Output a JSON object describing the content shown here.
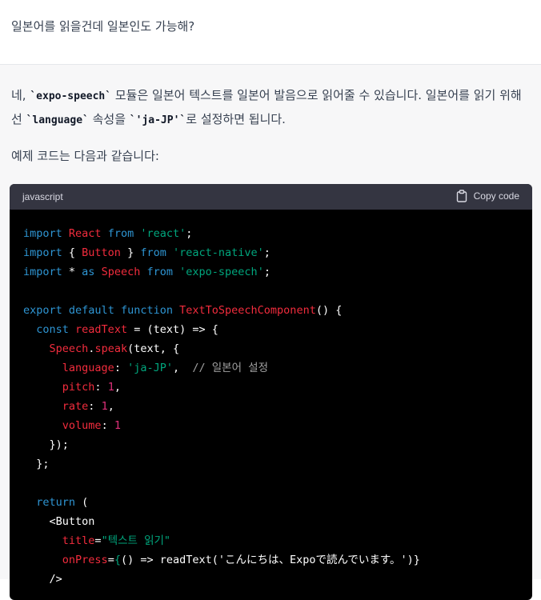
{
  "user_message": "일본어를 읽을건데 일본인도 가능해?",
  "answer": {
    "p1_a": "네, ",
    "p1_code1": "`expo-speech`",
    "p1_b": " 모듈은 일본어 텍스트를 일본어 발음으로 읽어줄 수 있습니다. 일본어를 읽기 위해선 ",
    "p1_code2": "`language`",
    "p1_c": " 속성을 ",
    "p1_code3": "`'ja-JP'`",
    "p1_d": "로 설정하면 됩니다.",
    "p2": "예제 코드는 다음과 같습니다:"
  },
  "code_block": {
    "language": "javascript",
    "copy_label": "Copy code",
    "colors": {
      "keyword": "#2e95d3",
      "identifier": "#f22c3d",
      "string": "#00a67d",
      "comment": "#a0a0a0",
      "number": "#df3079"
    },
    "lines": [
      [
        [
          "kw",
          "import"
        ],
        [
          "pl",
          " "
        ],
        [
          "id",
          "React"
        ],
        [
          "pl",
          " "
        ],
        [
          "kw",
          "from"
        ],
        [
          "pl",
          " "
        ],
        [
          "str",
          "'react'"
        ],
        [
          "pl",
          ";"
        ]
      ],
      [
        [
          "kw",
          "import"
        ],
        [
          "pl",
          " { "
        ],
        [
          "id",
          "Button"
        ],
        [
          "pl",
          " } "
        ],
        [
          "kw",
          "from"
        ],
        [
          "pl",
          " "
        ],
        [
          "str",
          "'react-native'"
        ],
        [
          "pl",
          ";"
        ]
      ],
      [
        [
          "kw",
          "import"
        ],
        [
          "pl",
          " * "
        ],
        [
          "kw",
          "as"
        ],
        [
          "pl",
          " "
        ],
        [
          "id",
          "Speech"
        ],
        [
          "pl",
          " "
        ],
        [
          "kw",
          "from"
        ],
        [
          "pl",
          " "
        ],
        [
          "str",
          "'expo-speech'"
        ],
        [
          "pl",
          ";"
        ]
      ],
      [],
      [
        [
          "kw",
          "export"
        ],
        [
          "pl",
          " "
        ],
        [
          "kw",
          "default"
        ],
        [
          "pl",
          " "
        ],
        [
          "kw",
          "function"
        ],
        [
          "pl",
          " "
        ],
        [
          "id",
          "TextToSpeechComponent"
        ],
        [
          "pl",
          "() {"
        ]
      ],
      [
        [
          "pl",
          "  "
        ],
        [
          "kw",
          "const"
        ],
        [
          "pl",
          " "
        ],
        [
          "id",
          "readText"
        ],
        [
          "pl",
          " = (text) => {"
        ]
      ],
      [
        [
          "pl",
          "    "
        ],
        [
          "id",
          "Speech"
        ],
        [
          "pl",
          "."
        ],
        [
          "id",
          "speak"
        ],
        [
          "pl",
          "(text, {"
        ]
      ],
      [
        [
          "pl",
          "      "
        ],
        [
          "id",
          "language"
        ],
        [
          "pl",
          ": "
        ],
        [
          "str",
          "'ja-JP'"
        ],
        [
          "pl",
          ",  "
        ],
        [
          "cm",
          "// 일본어 설정"
        ]
      ],
      [
        [
          "pl",
          "      "
        ],
        [
          "id",
          "pitch"
        ],
        [
          "pl",
          ": "
        ],
        [
          "num",
          "1"
        ],
        [
          "pl",
          ","
        ]
      ],
      [
        [
          "pl",
          "      "
        ],
        [
          "id",
          "rate"
        ],
        [
          "pl",
          ": "
        ],
        [
          "num",
          "1"
        ],
        [
          "pl",
          ","
        ]
      ],
      [
        [
          "pl",
          "      "
        ],
        [
          "id",
          "volume"
        ],
        [
          "pl",
          ": "
        ],
        [
          "num",
          "1"
        ]
      ],
      [
        [
          "pl",
          "    });"
        ]
      ],
      [
        [
          "pl",
          "  };"
        ]
      ],
      [],
      [
        [
          "pl",
          "  "
        ],
        [
          "kw",
          "return"
        ],
        [
          "pl",
          " ("
        ]
      ],
      [
        [
          "pl",
          "    <"
        ],
        [
          "pl",
          "Button"
        ]
      ],
      [
        [
          "pl",
          "      "
        ],
        [
          "id",
          "title"
        ],
        [
          "pl",
          "="
        ],
        [
          "str",
          "\"텍스트 읽기\""
        ]
      ],
      [
        [
          "pl",
          "      "
        ],
        [
          "id",
          "onPress"
        ],
        [
          "pl",
          "="
        ],
        [
          "str",
          "{"
        ],
        [
          "pl",
          "() => readText("
        ],
        [
          "pl",
          "'こんにちは、Expoで読んでいます。'"
        ],
        [
          "pl",
          ")}"
        ]
      ],
      [
        [
          "pl",
          "    />"
        ]
      ]
    ]
  }
}
